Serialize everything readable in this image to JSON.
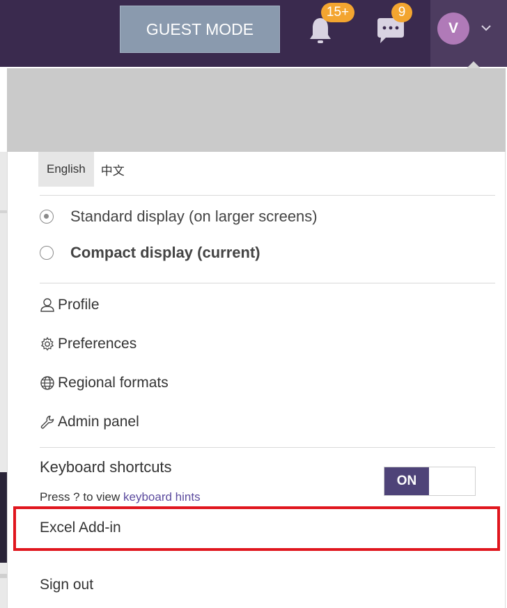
{
  "topbar": {
    "guest_mode_label": "GUEST MODE",
    "notifications": {
      "icon": "bell-icon",
      "badge": "15+"
    },
    "messages": {
      "icon": "chat-bubble-icon",
      "badge": "9"
    },
    "user": {
      "avatar_initial": "V",
      "icon": "chevron-down-icon"
    }
  },
  "menu": {
    "languages": [
      "English",
      "中文"
    ],
    "display_options": {
      "standard": "Standard display (on larger screens)",
      "compact": "Compact display",
      "compact_suffix": " (current)"
    },
    "items": [
      {
        "label": "Profile",
        "icon": "user-icon"
      },
      {
        "label": "Preferences",
        "icon": "gear-icon"
      },
      {
        "label": "Regional formats",
        "icon": "globe-icon"
      },
      {
        "label": "Admin panel",
        "icon": "wrench-icon"
      }
    ],
    "keyboard": {
      "label": "Keyboard shortcuts",
      "hint_prefix": "Press ? to view ",
      "hint_link": "keyboard hints",
      "toggle_state": "ON"
    },
    "excel_addin": "Excel Add-in",
    "sign_out": "Sign out"
  },
  "colors": {
    "topbar": "#3a2a4e",
    "badge": "#f3a530",
    "toggle_on": "#4e4378",
    "highlight": "#e0161e",
    "link": "#5b4a9e"
  }
}
